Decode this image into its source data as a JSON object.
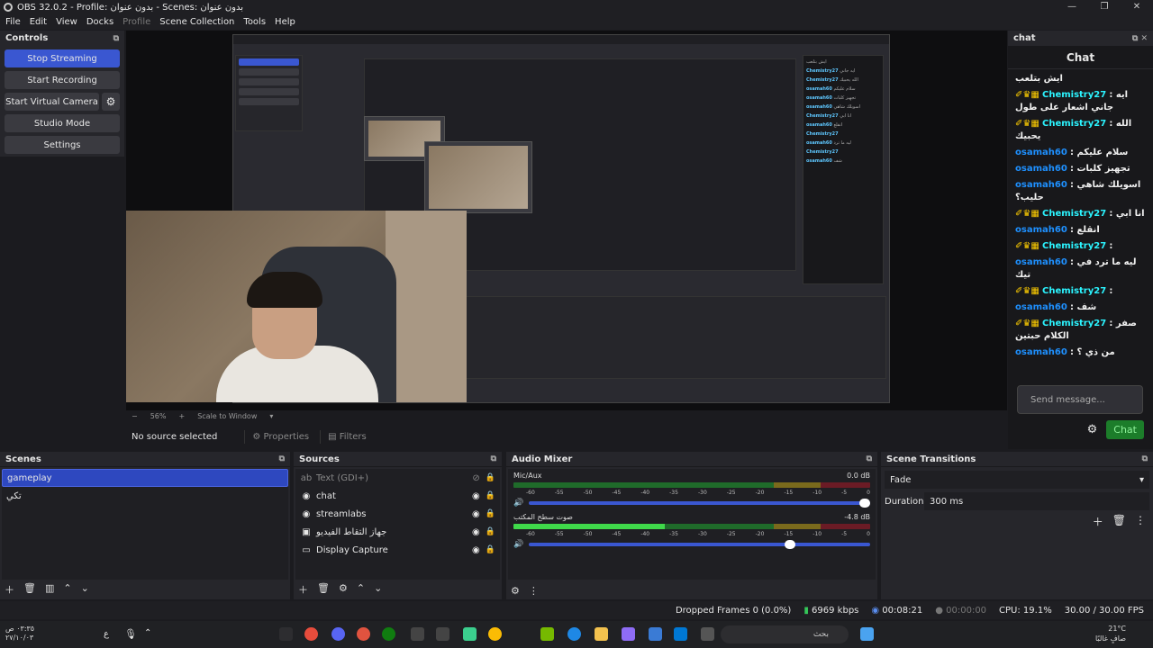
{
  "window": {
    "title": "OBS 32.0.2 - Profile: بدون عنوان - Scenes: بدون عنوان",
    "controls": [
      "—",
      "❐",
      "✕"
    ]
  },
  "menu": [
    "File",
    "Edit",
    "View",
    "Docks",
    "Profile",
    "Scene Collection",
    "Tools",
    "Help"
  ],
  "controls": {
    "title": "Controls",
    "stop_streaming": "Stop Streaming",
    "start_recording": "Start Recording",
    "start_virtual_camera": "Start Virtual Camera",
    "studio_mode": "Studio Mode",
    "settings": "Settings"
  },
  "preview": {
    "zoom": "56%",
    "zoom_plus": "+",
    "zoom_minus": "−",
    "scale": "Scale to Window",
    "no_source": "No source selected",
    "properties": "Properties",
    "filters": "Filters"
  },
  "chat": {
    "dock_title": "chat",
    "header": "Chat",
    "messages": [
      {
        "user": "",
        "text": "ايش بتلعب",
        "badges": ""
      },
      {
        "user": "Chemistry27",
        "text": ": ايه جاني اشعار على طول",
        "badges": "✐♛▦",
        "cls": "u1"
      },
      {
        "user": "Chemistry27",
        "text": ": الله يحبيك",
        "badges": "✐♛▦",
        "cls": "u1"
      },
      {
        "user": "osamah60",
        "text": ": سلام عليكم",
        "badges": "",
        "cls": "u2"
      },
      {
        "user": "osamah60",
        "text": ": تجهيز كلبات",
        "badges": "",
        "cls": "u2"
      },
      {
        "user": "osamah60",
        "text": ": اسويلك شاهي حليب؟",
        "badges": "",
        "cls": "u2"
      },
      {
        "user": "Chemistry27",
        "text": ": انا ابي",
        "badges": "✐♛▦",
        "cls": "u1"
      },
      {
        "user": "osamah60",
        "text": ": انقلع",
        "badges": "",
        "cls": "u2"
      },
      {
        "user": "Chemistry27",
        "text": ":",
        "badges": "✐♛▦",
        "cls": "u1"
      },
      {
        "user": "osamah60",
        "text": ": ليه ما ترد في تيك",
        "badges": "",
        "cls": "u2"
      },
      {
        "user": "Chemistry27",
        "text": ":",
        "badges": "✐♛▦",
        "cls": "u1"
      },
      {
        "user": "osamah60",
        "text": ": شف",
        "badges": "",
        "cls": "u2"
      },
      {
        "user": "Chemistry27",
        "text": ": صفر الكلام حبتين",
        "badges": "✐♛▦",
        "cls": "u1"
      },
      {
        "user": "osamah60",
        "text": ": من ذي ؟",
        "badges": "",
        "cls": "u2"
      }
    ],
    "placeholder": "Send message...",
    "send": "Chat"
  },
  "scenes": {
    "title": "Scenes",
    "items": [
      "gameplay",
      "تكي"
    ]
  },
  "sources": {
    "title": "Sources",
    "items": [
      {
        "icon": "ab",
        "name": "Text (GDI+)",
        "dim": true
      },
      {
        "icon": "◉",
        "name": "chat",
        "dim": false
      },
      {
        "icon": "◉",
        "name": "streamlabs",
        "dim": false
      },
      {
        "icon": "▣",
        "name": "جهاز التقاط الفيديو",
        "dim": false
      },
      {
        "icon": "▭",
        "name": "Display Capture",
        "dim": false
      }
    ]
  },
  "mixer": {
    "title": "Audio Mixer",
    "channels": [
      {
        "name": "Mic/Aux",
        "db": "0.0 dB",
        "level": 0.0,
        "volume": 1.0
      },
      {
        "name": "صوت سطح المكتب",
        "db": "-4.8 dB",
        "level": 0.58,
        "volume": 0.78
      }
    ],
    "ticks": [
      "-60",
      "-55",
      "-50",
      "-45",
      "-40",
      "-35",
      "-30",
      "-25",
      "-20",
      "-15",
      "-10",
      "-5",
      "0"
    ]
  },
  "transitions": {
    "title": "Scene Transitions",
    "selected": "Fade",
    "duration_label": "Duration",
    "duration": "300 ms"
  },
  "status": {
    "dropped": "Dropped Frames 0 (0.0%)",
    "kbps": "6969 kbps",
    "stream_time": "00:08:21",
    "rec_time": "00:00:00",
    "cpu": "CPU: 19.1%",
    "fps": "30.00 / 30.00 FPS"
  },
  "taskbar": {
    "time": "٠٣:٣٥ ص",
    "date": "٢٧/١٠/٠٣",
    "lang": "ع",
    "search": "بحث",
    "temp": "21°C",
    "weather": "صافٍ غالبًا"
  },
  "colors": {
    "accent": "#3a57d1",
    "chat_green": "#1c7d2a"
  }
}
